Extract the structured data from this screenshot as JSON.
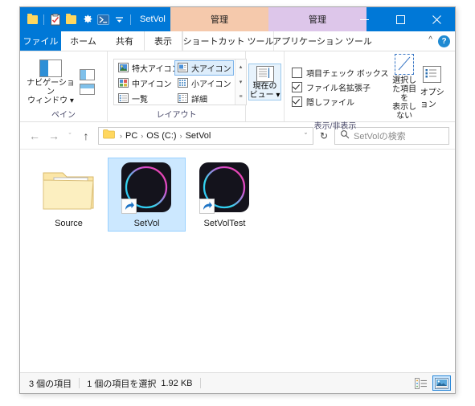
{
  "window": {
    "title": "SetVol",
    "quick_access": [
      {
        "name": "folder-icon",
        "label": "SetVol"
      },
      {
        "name": "properties-icon",
        "label": ""
      },
      {
        "name": "new-folder-icon",
        "label": ""
      },
      {
        "name": "gear-icon",
        "label": ""
      },
      {
        "name": "powershell-icon",
        "label": ""
      },
      {
        "name": "customize-dropdown-icon",
        "label": ""
      }
    ],
    "controls": {
      "minimize": "─",
      "maximize": "☐",
      "close": "✕"
    }
  },
  "contextual_tabs": [
    {
      "group_label": "管理",
      "tab_label": "ショートカット ツール",
      "color": "#f5c9ac"
    },
    {
      "group_label": "管理",
      "tab_label": "アプリケーション ツール",
      "color": "#ddc6ea"
    }
  ],
  "tabs": [
    {
      "label": "ファイル",
      "active": false,
      "style": "file"
    },
    {
      "label": "ホーム",
      "active": false,
      "style": "normal"
    },
    {
      "label": "共有",
      "active": false,
      "style": "normal"
    },
    {
      "label": "表示",
      "active": true,
      "style": "normal"
    }
  ],
  "ribbon": {
    "collapse_icon": "^",
    "help_icon": "?",
    "groups": {
      "pane": {
        "label": "ペイン",
        "nav_button": "ナビゲーション\nウィンドウ",
        "nav_button_line1": "ナビゲーション",
        "nav_button_line2": "ウィンドウ ▾",
        "preview_pane": "プレビュー ウィンドウ",
        "details_pane": "詳細ウィンドウ"
      },
      "layout": {
        "label": "レイアウト",
        "options": [
          {
            "label": "特大アイコン",
            "selected": false
          },
          {
            "label": "大アイコン",
            "selected": true
          },
          {
            "label": "中アイコン",
            "selected": false
          },
          {
            "label": "小アイコン",
            "selected": false
          },
          {
            "label": "一覧",
            "selected": false
          },
          {
            "label": "詳細",
            "selected": false
          }
        ],
        "scroll_up": "▴",
        "scroll_down": "▾",
        "more": "≡"
      },
      "current_view": {
        "line1": "現在の",
        "line2": "ビュー ▾"
      },
      "show_hide": {
        "label": "表示/非表示",
        "checkboxes": [
          {
            "label": "項目チェック ボックス",
            "checked": false
          },
          {
            "label": "ファイル名拡張子",
            "checked": true
          },
          {
            "label": "隠しファイル",
            "checked": true
          }
        ],
        "hide_selected_line1": "選択した項目を",
        "hide_selected_line2": "表示しない",
        "options_label": "オプション"
      }
    }
  },
  "address_bar": {
    "back": "←",
    "forward": "→",
    "recent": "ˇ",
    "up": "↑",
    "breadcrumbs": [
      "PC",
      "OS (C:)",
      "SetVol"
    ],
    "separator": "›",
    "dropdown": "ˇ",
    "refresh": "↻",
    "search_placeholder": "SetVolの検索"
  },
  "files": [
    {
      "name": "Source",
      "type": "folder",
      "selected": false,
      "shortcut": false
    },
    {
      "name": "SetVol",
      "type": "app-shortcut",
      "selected": true,
      "shortcut": true
    },
    {
      "name": "SetVolTest",
      "type": "app-shortcut",
      "selected": false,
      "shortcut": true
    }
  ],
  "status_bar": {
    "item_count": "3 個の項目",
    "selection": "1 個の項目を選択",
    "size": "1.92 KB",
    "view_details": "詳細表示",
    "view_large_icons": "大アイコン表示"
  },
  "colors": {
    "accent": "#0078d7",
    "selection": "#cce8ff",
    "shortcut_tab": "#f5c9ac",
    "app_tab": "#ddc6ea",
    "icon_cyan": "#35d8f0",
    "icon_magenta": "#f03cb0",
    "icon_purple": "#9b51e0"
  }
}
